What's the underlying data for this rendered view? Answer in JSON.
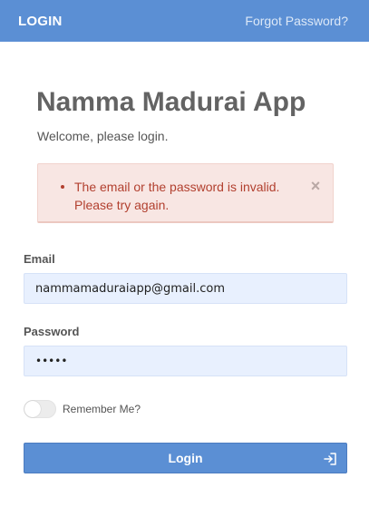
{
  "header": {
    "brand": "LOGIN",
    "forgot_link": "Forgot Password?",
    "background": "#5b8fd4"
  },
  "main": {
    "title": "Namma Madurai App",
    "subtitle": "Welcome, please login."
  },
  "alert": {
    "messages": [
      "The email or the password is invalid. Please try again."
    ],
    "close_symbol": "×",
    "color": "#b2402f"
  },
  "form": {
    "email_label": "Email",
    "email_value": "nammamaduraiapp@gmail.com",
    "password_label": "Password",
    "password_value": "•••••",
    "remember_label": "Remember Me?",
    "remember_checked": false,
    "login_label": "Login",
    "login_icon": "sign-in-icon"
  }
}
